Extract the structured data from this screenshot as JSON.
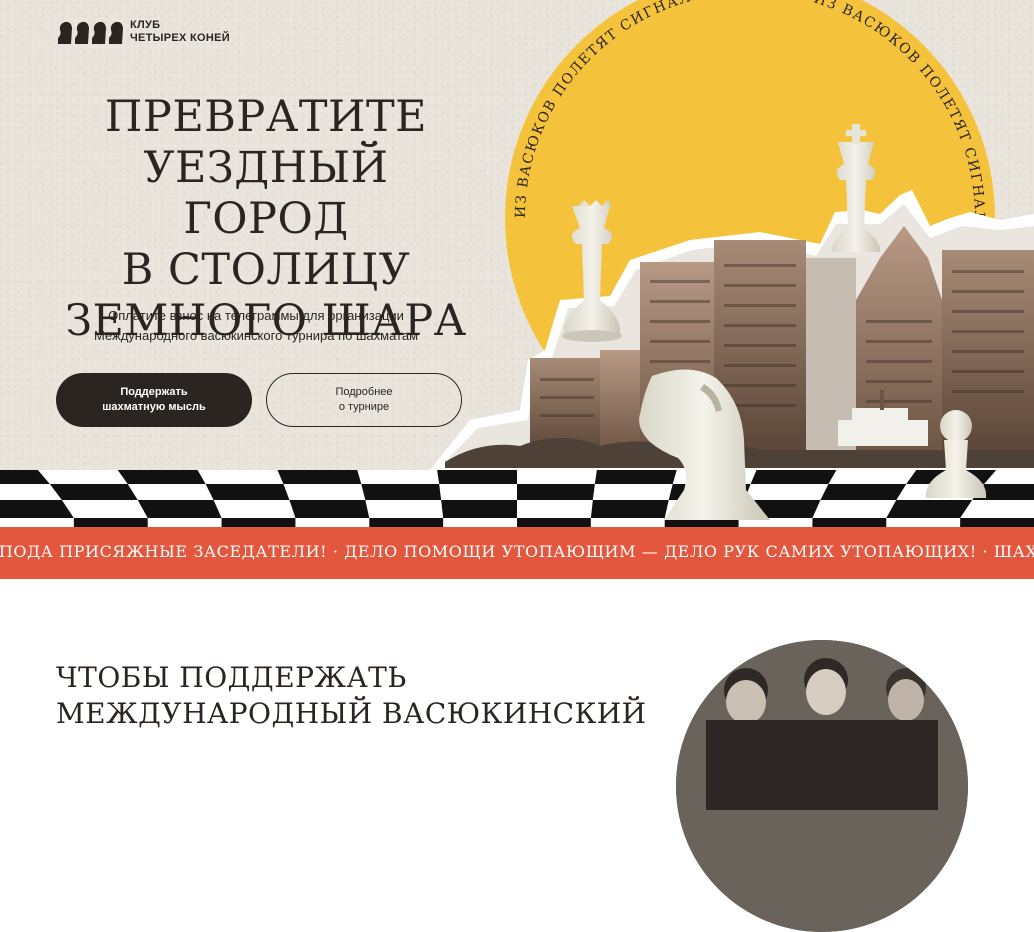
{
  "logo": {
    "line1": "КЛУБ",
    "line2": "ЧЕТЫРЕХ КОНЕЙ",
    "icon": "four-knights-icon"
  },
  "hero": {
    "headline": [
      "ПРЕВРАТИТЕ",
      "УЕЗДНЫЙ ГОРОД",
      "В СТОЛИЦУ",
      "ЗЕМНОГО ШАРА"
    ],
    "subtext": [
      "Оплатите взнос на телеграммы для организации",
      "Международного васюкинского турнира по шахматам"
    ],
    "primary_button": [
      "Поддержать",
      "шахматную мысль"
    ],
    "secondary_button": [
      "Подробнее",
      "о турнире"
    ],
    "circle_text": "ИЗ ВАСЮКОВ ПОЛЕТЯТ СИГНАЛЫ НА МАРС · ИЗ ВАСЮКОВ ПОЛЕТЯТ СИГНАЛЫ НА МАРС ·"
  },
  "ticker": {
    "text": "СПОДА ПРИСЯЖНЫЕ ЗАСЕДАТЕЛИ! · ДЕЛО ПОМОЩИ УТОПАЮЩИМ — ДЕЛО РУК САМИХ УТОПАЮЩИХ! · ШАХМАТЫ ДВИГАЮТ"
  },
  "section": {
    "title": [
      "ЧТОБЫ ПОДДЕРЖАТЬ",
      "МЕЖДУНАРОДНЫЙ ВАСЮКИНСКИЙ"
    ]
  },
  "colors": {
    "background": "#e9e4dc",
    "ink": "#2b2522",
    "sun": "#f5c33b",
    "ticker": "#e4573f"
  }
}
